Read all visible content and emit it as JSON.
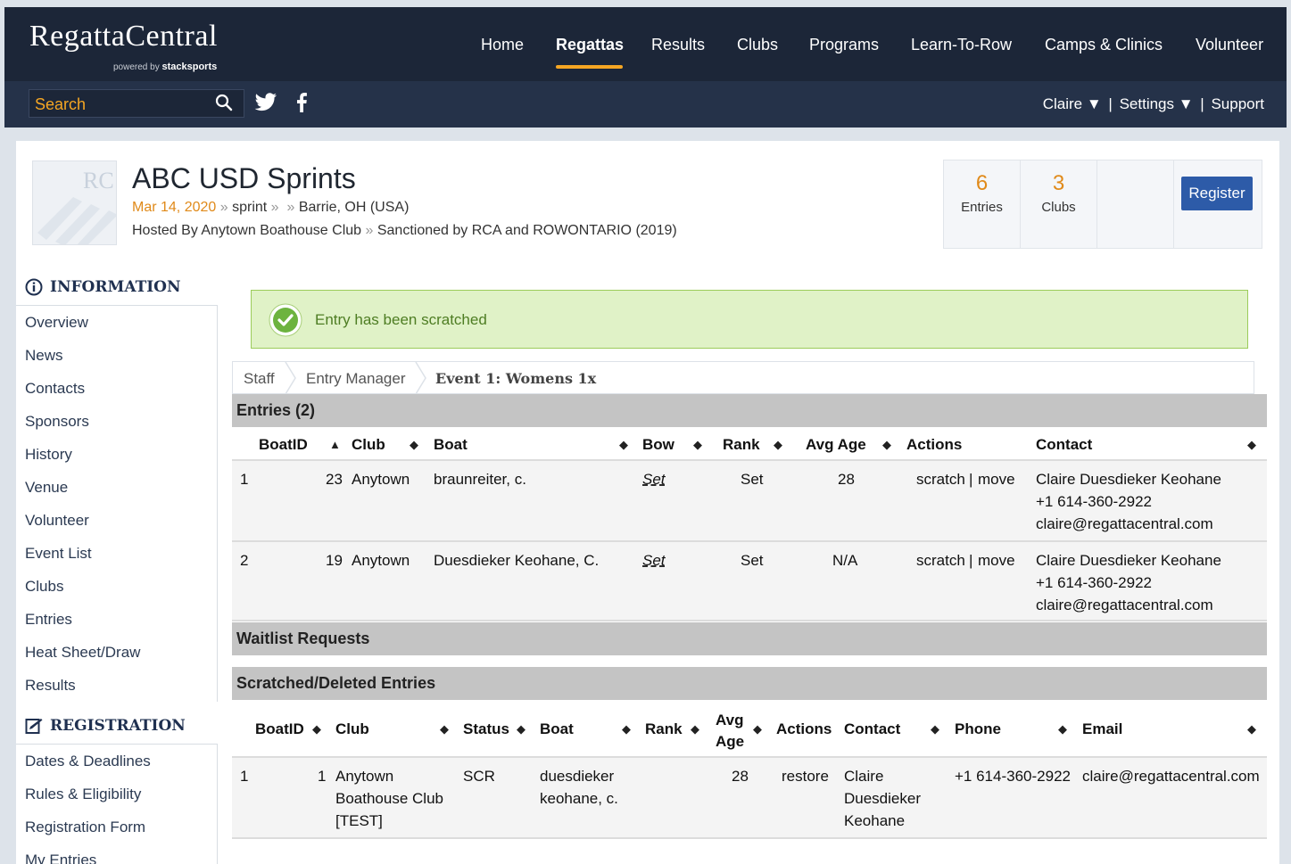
{
  "brand": {
    "name": "RegattaCentral",
    "powered_by": "powered by",
    "powered_brand": "stacksports"
  },
  "nav": [
    "Home",
    "Regattas",
    "Results",
    "Clubs",
    "Programs",
    "Learn-To-Row",
    "Camps & Clinics",
    "Volunteer"
  ],
  "search": {
    "placeholder": "Search"
  },
  "user_menu": {
    "user": "Claire ▼",
    "settings": "Settings ▼",
    "support": "Support",
    "divider": "|"
  },
  "regatta": {
    "logo_initials": "RC",
    "title": "ABC USD Sprints",
    "date": "Mar 14, 2020",
    "type": "sprint",
    "location": "Barrie, OH (USA)",
    "host": "Hosted By Anytown Boathouse Club",
    "sanction": "Sanctioned by RCA and ROWONTARIO (2019)",
    "sep": "»",
    "entries_count": "6",
    "entries_label": "Entries",
    "clubs_count": "3",
    "clubs_label": "Clubs",
    "register_label": "Register"
  },
  "sidebar": {
    "info_heading": "INFORMATION",
    "info_items": [
      "Overview",
      "News",
      "Contacts",
      "Sponsors",
      "History",
      "Venue",
      "Volunteer",
      "Event List",
      "Clubs",
      "Entries",
      "Heat Sheet/Draw",
      "Results"
    ],
    "reg_heading": "REGISTRATION",
    "reg_items": [
      "Dates & Deadlines",
      "Rules & Eligibility",
      "Registration Form",
      "My Entries"
    ]
  },
  "alert": {
    "message": "Entry has been scratched"
  },
  "breadcrumb": [
    "Staff",
    "Entry Manager",
    "Event 1: Womens 1x"
  ],
  "entries": {
    "title": "Entries (2)",
    "columns": [
      "BoatID",
      "Club",
      "Boat",
      "Bow",
      "Rank",
      "Avg Age",
      "Actions",
      "Contact"
    ],
    "rows": [
      {
        "boat_id": "1",
        "club_num": "23",
        "club": "Anytown",
        "boat": "braunreiter, c.",
        "bow": "Set",
        "rank": "Set",
        "avg_age": "28",
        "scratch": "scratch",
        "move": "move",
        "action_sep": "|",
        "contact_name": "Claire Duesdieker Keohane",
        "contact_phone": "+1 614-360-2922",
        "contact_email": "claire@regattacentral.com"
      },
      {
        "boat_id": "2",
        "club_num": "19",
        "club": "Anytown",
        "boat": "Duesdieker Keohane, C.",
        "bow": "Set",
        "rank": "Set",
        "avg_age": "N/A",
        "scratch": "scratch",
        "move": "move",
        "action_sep": "|",
        "contact_name": "Claire Duesdieker Keohane",
        "contact_phone": "+1 614-360-2922",
        "contact_email": "claire@regattacentral.com"
      }
    ]
  },
  "waitlist": {
    "title": "Waitlist Requests"
  },
  "scratched": {
    "title": "Scratched/Deleted Entries",
    "columns": [
      "BoatID",
      "Club",
      "Status",
      "Boat",
      "Rank",
      "Avg Age",
      "Actions",
      "Contact",
      "Phone",
      "Email"
    ],
    "rows": [
      {
        "boat_id": "1",
        "num": "1",
        "club": "Anytown Boathouse Club [TEST]",
        "status": "SCR",
        "boat": "duesdieker keohane, c.",
        "avg_age": "28",
        "action": "restore",
        "contact": "Claire Duesdieker Keohane",
        "phone": "+1 614-360-2922",
        "email": "claire@regattacentral.com"
      }
    ]
  },
  "colors": {
    "nav_bg": "#1c2638",
    "subbar_bg": "#253249",
    "accent": "#f5a623",
    "link": "#2a4bd7",
    "success_bg": "#e0f2c7"
  }
}
